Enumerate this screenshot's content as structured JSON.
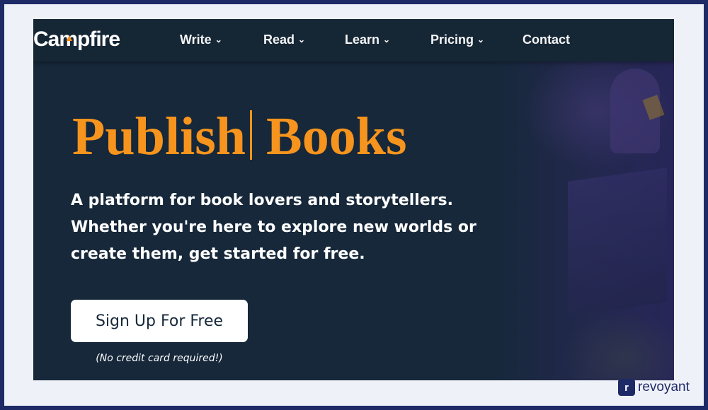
{
  "brand": {
    "logo_text": "Campfire",
    "accent_color": "#f7941d",
    "logo_icon": "flame-icon"
  },
  "nav": {
    "items": [
      {
        "label": "Write",
        "has_dropdown": true
      },
      {
        "label": "Read",
        "has_dropdown": true
      },
      {
        "label": "Learn",
        "has_dropdown": true
      },
      {
        "label": "Pricing",
        "has_dropdown": true
      },
      {
        "label": "Contact",
        "has_dropdown": false
      }
    ],
    "dropdown_glyph": "⌄"
  },
  "hero": {
    "title_word1": "Publish",
    "title_word2": "Books",
    "description": "A platform for book lovers and storytellers. Whether you're here to explore new worlds or create them, get started for free.",
    "cta_label": "Sign Up For Free",
    "cta_note": "(No credit card required!)"
  },
  "watermark": {
    "mark": "r",
    "text": "revoyant"
  },
  "colors": {
    "page_bg": "#16283a",
    "nav_bg": "#152635",
    "frame": "#1e2a66"
  }
}
